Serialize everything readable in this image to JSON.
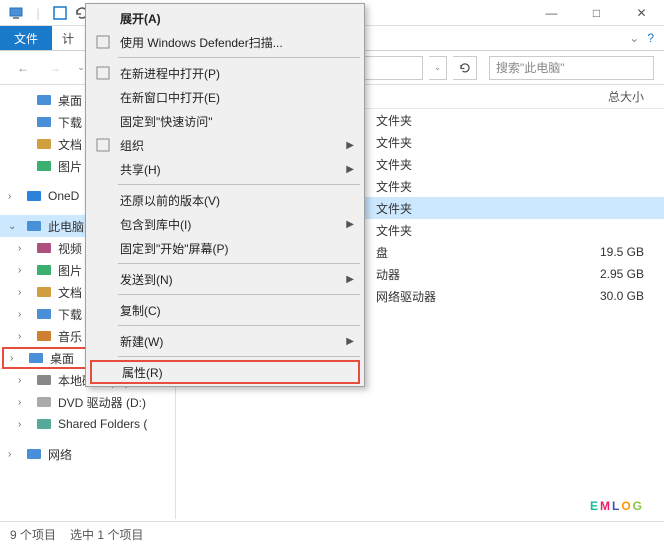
{
  "titlebar": {
    "min": "—",
    "max": "□",
    "close": "✕"
  },
  "ribbon": {
    "file": "文件",
    "computer": "计",
    "help_icon": "?"
  },
  "toolbar": {
    "search_placeholder": "搜索\"此电脑\""
  },
  "sidebar": {
    "items": [
      {
        "label": "桌面",
        "icon": "desktop"
      },
      {
        "label": "下载",
        "icon": "download"
      },
      {
        "label": "文档",
        "icon": "document"
      },
      {
        "label": "图片",
        "icon": "picture"
      }
    ],
    "onedrive": "OneD",
    "thispc": "此电脑",
    "pc_children": [
      {
        "label": "视频",
        "icon": "video"
      },
      {
        "label": "图片",
        "icon": "picture"
      },
      {
        "label": "文档",
        "icon": "document"
      },
      {
        "label": "下载",
        "icon": "download"
      },
      {
        "label": "音乐",
        "icon": "music"
      },
      {
        "label": "桌面",
        "icon": "desktop",
        "highlighted": true
      },
      {
        "label": "本地磁盘 (C:)",
        "icon": "disk"
      },
      {
        "label": "DVD 驱动器 (D:)",
        "icon": "dvd"
      },
      {
        "label": "Shared Folders (",
        "icon": "netdrive"
      }
    ],
    "network": "网络"
  },
  "columns": {
    "size": "总大小"
  },
  "files": [
    {
      "name": "",
      "type": "文件夹",
      "size": ""
    },
    {
      "name": "",
      "type": "文件夹",
      "size": ""
    },
    {
      "name": "",
      "type": "文件夹",
      "size": ""
    },
    {
      "name": "",
      "type": "文件夹",
      "size": ""
    },
    {
      "name": "",
      "type": "文件夹",
      "size": "",
      "sel": true
    },
    {
      "name": "",
      "type": "文件夹",
      "size": ""
    },
    {
      "name": "",
      "type": "盘",
      "size": "19.5 GB"
    },
    {
      "name": "",
      "type": "动器",
      "size": "2.95 GB"
    },
    {
      "name": "Shared Folders (\\...",
      "type": "网络驱动器",
      "size": "30.0 GB",
      "icon": true
    }
  ],
  "context_menu": [
    {
      "label": "展开(A)",
      "bold": true
    },
    {
      "label": "使用 Windows Defender扫描...",
      "icon": "shield"
    },
    {
      "sep": true
    },
    {
      "label": "在新进程中打开(P)",
      "icon": "window"
    },
    {
      "label": "在新窗口中打开(E)"
    },
    {
      "label": "固定到\"快速访问\""
    },
    {
      "label": "组织",
      "icon": "copy",
      "arrow": true
    },
    {
      "label": "共享(H)",
      "arrow": true
    },
    {
      "sep": true
    },
    {
      "label": "还原以前的版本(V)"
    },
    {
      "label": "包含到库中(I)",
      "arrow": true
    },
    {
      "label": "固定到\"开始\"屏幕(P)"
    },
    {
      "sep": true
    },
    {
      "label": "发送到(N)",
      "arrow": true
    },
    {
      "sep": true
    },
    {
      "label": "复制(C)"
    },
    {
      "sep": true
    },
    {
      "label": "新建(W)",
      "arrow": true
    },
    {
      "sep": true
    },
    {
      "label": "属性(R)",
      "highlighted": true
    }
  ],
  "statusbar": {
    "count": "9 个项目",
    "selected": "选中 1 个项目"
  },
  "logo": [
    "E",
    "M",
    "L",
    "O",
    "G"
  ]
}
